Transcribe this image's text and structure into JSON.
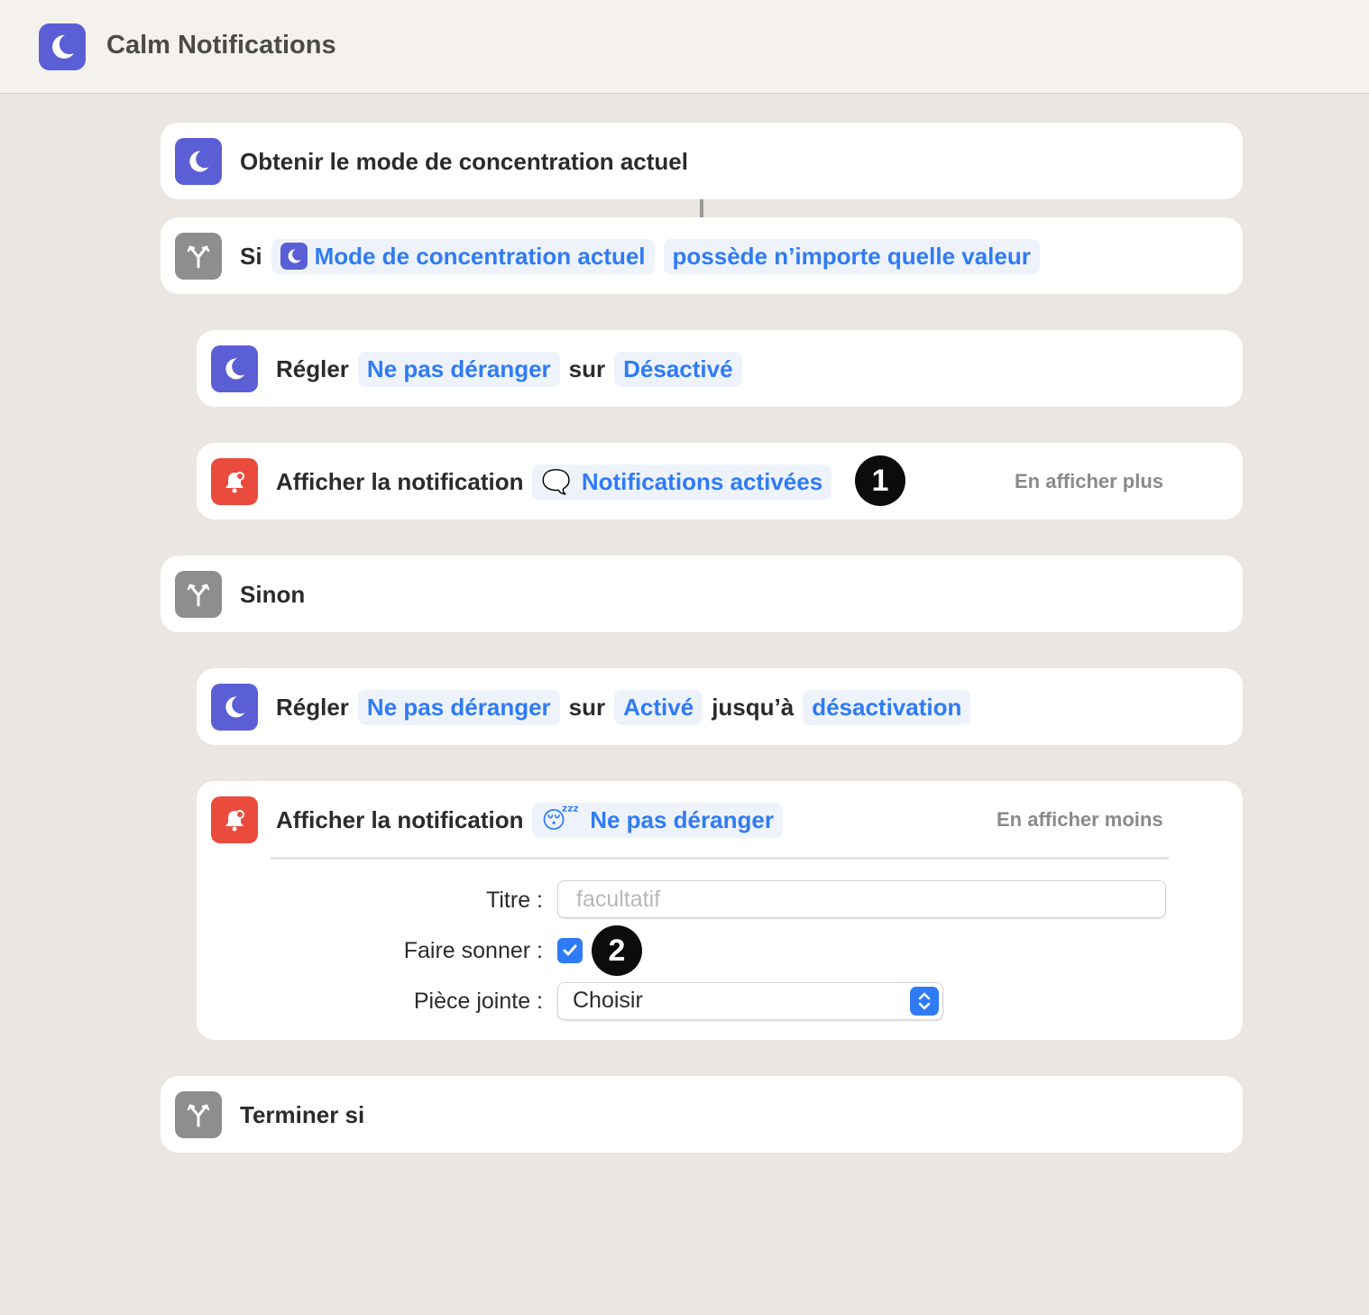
{
  "window": {
    "title": "Calm Notifications",
    "app_icon": "moon-icon"
  },
  "colors": {
    "focus_purple": "#5a5fd6",
    "control_gray": "#8e8e8e",
    "notification_red": "#ea4b3d",
    "accent_blue": "#2f7bf5",
    "background": "#ebe6e1"
  },
  "actions": {
    "get_focus": {
      "icon": "moon-icon",
      "label": "Obtenir le mode de concentration actuel"
    },
    "if_block": {
      "icon": "branch-icon",
      "keyword": "Si",
      "variable_icon": "moon-icon",
      "variable": "Mode de concentration actuel",
      "condition": "possède n’importe quelle valeur"
    },
    "set_dnd_off": {
      "icon": "moon-icon",
      "verb": "Régler",
      "target": "Ne pas déranger",
      "connector": "sur",
      "value": "Désactivé"
    },
    "notify_on": {
      "icon": "bell-icon",
      "verb": "Afficher la notification",
      "emoji": "🗨️",
      "message": "Notifications activées",
      "badge": "1",
      "toggle": "En afficher plus"
    },
    "otherwise": {
      "icon": "branch-icon",
      "keyword": "Sinon"
    },
    "set_dnd_on": {
      "icon": "moon-icon",
      "verb": "Régler",
      "target": "Ne pas déranger",
      "connector": "sur",
      "value": "Activé",
      "until_label": "jusqu’à",
      "until_value": "désactivation"
    },
    "notify_dnd": {
      "icon": "bell-icon",
      "verb": "Afficher la notification",
      "emoji": "😴",
      "message": "Ne pas déranger",
      "toggle": "En afficher moins",
      "fields": {
        "title_label": "Titre :",
        "title_value": "",
        "title_placeholder": "facultatif",
        "sound_label": "Faire sonner :",
        "sound_checked": true,
        "badge": "2",
        "attachment_label": "Pièce jointe :",
        "attachment_value": "Choisir"
      }
    },
    "end_if": {
      "icon": "branch-icon",
      "keyword": "Terminer si"
    }
  }
}
